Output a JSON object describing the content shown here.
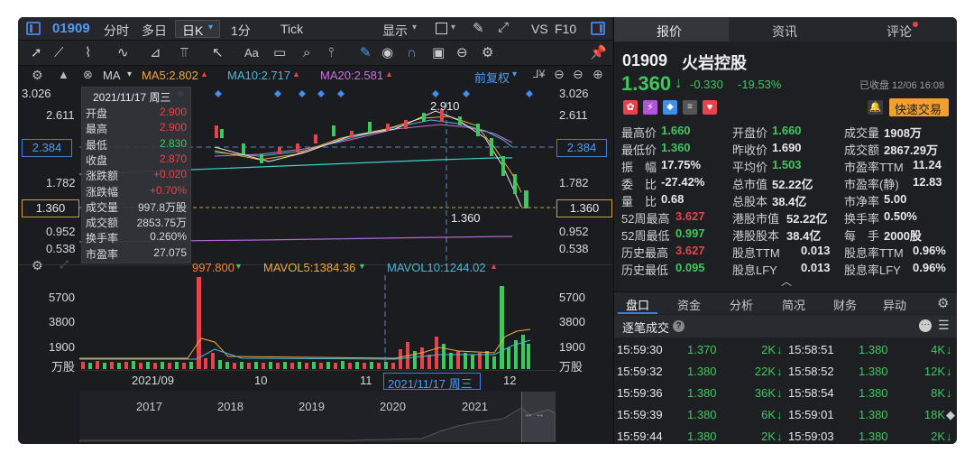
{
  "topbar": {
    "code": "01909",
    "tabs": [
      "分时",
      "多日"
    ],
    "period_selected": "日K",
    "period_options": [
      "1分",
      "Tick"
    ],
    "display_label": "显示",
    "vs_label": "VS",
    "f10_label": "F10"
  },
  "toolbar": {
    "aa_label": "Aa"
  },
  "ma_bar": {
    "ma_label": "MA",
    "ma5": "MA5:2.802",
    "ma10": "MA10:2.717",
    "ma20": "MA20:2.581",
    "adjust": "前复权"
  },
  "price_axis": [
    "3.026",
    "2.611",
    "2.384",
    "1.782",
    "1.360",
    "0.952",
    "0.538"
  ],
  "price_axis_right": [
    "3.026",
    "2.611",
    "2.384",
    "1.782",
    "1.360",
    "0.952",
    "0.538"
  ],
  "chart_labels": {
    "high_mark": "2.910",
    "low_mark": "1.360"
  },
  "tooltip": {
    "date": "2021/11/17 周三",
    "rows": [
      {
        "label": "开盘",
        "value": "2.900",
        "color": "#e6434b"
      },
      {
        "label": "最高",
        "value": "2.900",
        "color": "#e6434b"
      },
      {
        "label": "最低",
        "value": "2.830",
        "color": "#3fc75f"
      },
      {
        "label": "收盘",
        "value": "2.870",
        "color": "#e6434b"
      },
      {
        "label": "涨跌额",
        "value": "+0.020",
        "color": "#e6434b"
      },
      {
        "label": "涨跌幅",
        "value": "+0.70%",
        "color": "#e6434b"
      },
      {
        "label": "成交量",
        "value": "997.8万股",
        "color": "#d9d9dc"
      },
      {
        "label": "成交额",
        "value": "2853.75万",
        "color": "#d9d9dc"
      },
      {
        "label": "换手率",
        "value": "0.260%",
        "color": "#d9d9dc"
      },
      {
        "label": "市盈率",
        "value": "27.075",
        "color": "#d9d9dc"
      }
    ]
  },
  "vol_bar": {
    "vol": "997.800",
    "mavol5": "MAVOL5:1384.36",
    "mavol10": "MAVOL10:1244.02"
  },
  "vol_axis": [
    "5700",
    "3800",
    "1900",
    "万股"
  ],
  "vol_axis_right": [
    "5700",
    "3800",
    "1900",
    "万股"
  ],
  "date_axis": [
    "2021/09",
    "10",
    "11",
    "2021/11/17 周三",
    "12"
  ],
  "overview_years": [
    "2017",
    "2018",
    "2019",
    "2020",
    "2021"
  ],
  "right": {
    "tabs": [
      "报价",
      "资讯",
      "评论"
    ],
    "code": "01909",
    "name": "火岩控股",
    "price": "1.360",
    "change": "-0.330",
    "change_pct": "-19.53%",
    "status": "已收盘 12/06 16:08",
    "quick_trade": "快速交易",
    "quote_cols": [
      [
        {
          "label": "最高价",
          "value": "1.660",
          "color": "#3fc75f"
        },
        {
          "label": "最低价",
          "value": "1.360",
          "color": "#3fc75f"
        },
        {
          "label": "振　幅",
          "value": "17.75%",
          "color": "#e8e8ea"
        },
        {
          "label": "委　比",
          "value": "-27.42%",
          "color": "#e8e8ea"
        },
        {
          "label": "量　比",
          "value": "0.68",
          "color": "#e8e8ea"
        },
        {
          "label": "52周最高",
          "value": "3.627",
          "color": "#e6434b"
        },
        {
          "label": "52周最低",
          "value": "0.997",
          "color": "#3fc75f"
        },
        {
          "label": "历史最高",
          "value": "3.627",
          "color": "#e6434b"
        },
        {
          "label": "历史最低",
          "value": "0.095",
          "color": "#3fc75f"
        }
      ],
      [
        {
          "label": "开盘价",
          "value": "1.660",
          "color": "#3fc75f"
        },
        {
          "label": "昨收价",
          "value": "1.690",
          "color": "#e8e8ea"
        },
        {
          "label": "平均价",
          "value": "1.503",
          "color": "#3fc75f"
        },
        {
          "label": "总市值",
          "value": "52.22亿",
          "color": "#e8e8ea"
        },
        {
          "label": "总股本",
          "value": "38.4亿",
          "color": "#e8e8ea"
        },
        {
          "label": "港股市值",
          "value": "52.22亿",
          "color": "#e8e8ea"
        },
        {
          "label": "港股股本",
          "value": "38.4亿",
          "color": "#e8e8ea"
        },
        {
          "label": "股息TTM",
          "value": "0.013",
          "color": "#e8e8ea"
        },
        {
          "label": "股息LFY",
          "value": "0.013",
          "color": "#e8e8ea"
        }
      ],
      [
        {
          "label": "成交量",
          "value": "1908万",
          "color": "#e8e8ea"
        },
        {
          "label": "成交额",
          "value": "2867.29万",
          "color": "#e8e8ea"
        },
        {
          "label": "市盈率TTM",
          "value": "11.24",
          "color": "#e8e8ea"
        },
        {
          "label": "市盈率(静)",
          "value": "12.83",
          "color": "#e8e8ea"
        },
        {
          "label": "市净率",
          "value": "5.00",
          "color": "#e8e8ea"
        },
        {
          "label": "换手率",
          "value": "0.50%",
          "color": "#e8e8ea"
        },
        {
          "label": "每　手",
          "value": "2000股",
          "color": "#e8e8ea"
        },
        {
          "label": "股息率TTM",
          "value": "0.96%",
          "color": "#e8e8ea"
        },
        {
          "label": "股息率LFY",
          "value": "0.96%",
          "color": "#e8e8ea"
        }
      ]
    ],
    "sub_tabs": [
      "盘口",
      "资金",
      "分析",
      "简况",
      "财务",
      "异动"
    ],
    "ticks_title": "逐笔成交",
    "ticks": [
      {
        "t1": "15:59:30",
        "p1": "1.370",
        "v1": "2K",
        "t2": "15:58:51",
        "p2": "1.380",
        "v2": "4K"
      },
      {
        "t1": "15:59:32",
        "p1": "1.380",
        "v1": "22K",
        "t2": "15:58:52",
        "p2": "1.380",
        "v2": "12K"
      },
      {
        "t1": "15:59:36",
        "p1": "1.380",
        "v1": "36K",
        "t2": "15:58:54",
        "p2": "1.380",
        "v2": "8K"
      },
      {
        "t1": "15:59:39",
        "p1": "1.380",
        "v1": "6K",
        "t2": "15:59:01",
        "p2": "1.380",
        "v2": "18K"
      },
      {
        "t1": "15:59:44",
        "p1": "1.380",
        "v1": "2K",
        "t2": "15:59:03",
        "p2": "1.380",
        "v2": "2K"
      }
    ]
  },
  "colors": {
    "up": "#e6434b",
    "down": "#3fc75f",
    "accent": "#3f7fd6",
    "ma5": "#f2a93b",
    "ma10": "#4bb8d6",
    "ma20": "#c873d8",
    "orange": "#f0a030"
  }
}
